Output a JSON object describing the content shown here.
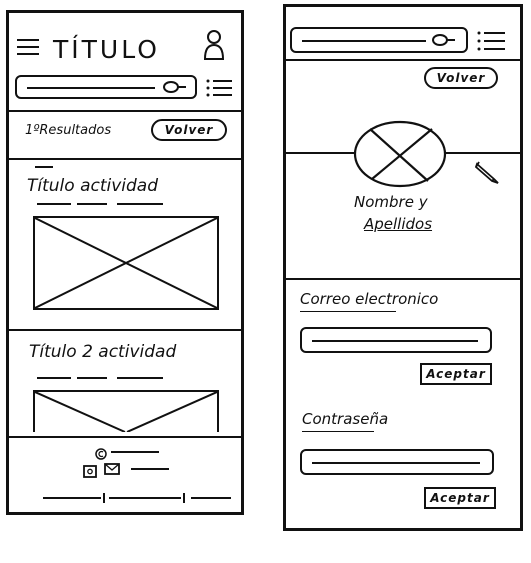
{
  "left_screen": {
    "title": "TÍTULO",
    "results_label": "1ºResultados",
    "back_button": "Volver",
    "activity1_title": "Título actividad",
    "activity2_title": "Título 2 actividad"
  },
  "right_screen": {
    "back_button": "Volver",
    "profile_name": "Nombre y",
    "profile_surname": "Apellidos",
    "email_label": "Correo electronico",
    "accept1_button": "Aceptar",
    "password_label": "Contraseña",
    "accept2_button": "Aceptar"
  },
  "icons": {
    "menu": "hamburger-menu-icon",
    "user": "user-icon",
    "search": "search-icon",
    "list": "list-icon",
    "image_placeholder": "image-placeholder-icon",
    "edit": "pencil-icon",
    "copyright": "copyright-icon",
    "social": "social-icons"
  }
}
